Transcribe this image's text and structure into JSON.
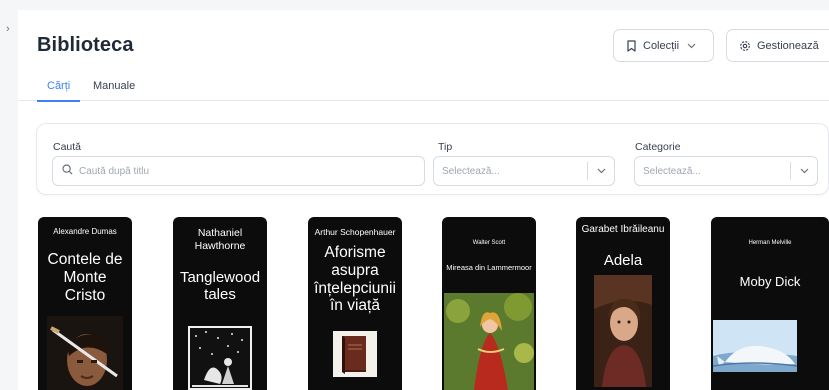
{
  "page": {
    "title": "Biblioteca"
  },
  "header": {
    "collections_label": "Colecții",
    "manage_label": "Gestionează"
  },
  "tabs": [
    {
      "label": "Cărți",
      "active": true
    },
    {
      "label": "Manuale",
      "active": false
    }
  ],
  "filters": {
    "search_label": "Caută",
    "search_placeholder": "Caută după titlu",
    "type_label": "Tip",
    "type_placeholder": "Selectează...",
    "category_label": "Categorie",
    "category_placeholder": "Selectează..."
  },
  "books": [
    {
      "author": "Alexandre Dumas",
      "title": "Contele de Monte Cristo"
    },
    {
      "author": "Nathaniel Hawthorne",
      "title": "Tanglewood tales"
    },
    {
      "author": "Arthur Schopenhauer",
      "title": "Aforisme asupra înțelepciunii în viață"
    },
    {
      "author": "Walter Scott",
      "title": "Mireasa din Lammermoor"
    },
    {
      "author": "Garabet Ibrăileanu",
      "title": "Adela"
    },
    {
      "author": "Herman Melville",
      "title": "Moby Dick"
    }
  ],
  "colors": {
    "accent": "#3b82f6",
    "book_cover": "#0c0c0c",
    "page_bg": "#f5f6f8"
  },
  "icons": [
    "sidebar-collapse-icon",
    "bookmark-icon",
    "chevron-down-icon",
    "gear-icon",
    "search-icon"
  ]
}
